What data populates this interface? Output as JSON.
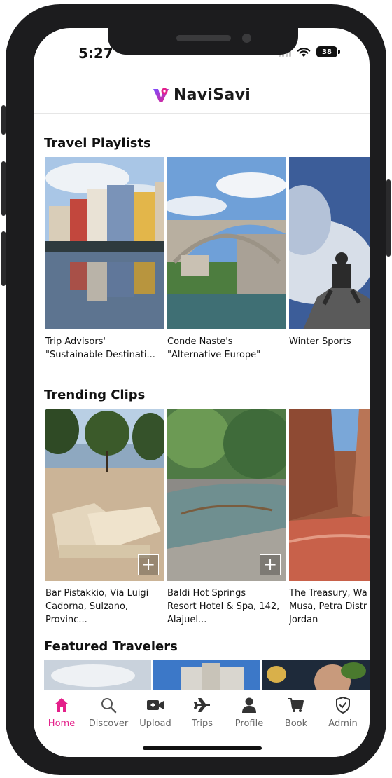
{
  "status_bar": {
    "time": "5:27",
    "battery": "38"
  },
  "header": {
    "app_name": "NaviSavi"
  },
  "travel_playlists": {
    "title": "Travel Playlists",
    "items": [
      {
        "label": "Trip Advisors'\n\"Sustainable Destinati..."
      },
      {
        "label": "Conde Naste's\n\"Alternative Europe\""
      },
      {
        "label": "Winter Sports"
      }
    ]
  },
  "trending_clips": {
    "title": "Trending Clips",
    "items": [
      {
        "label": "Bar Pistakkio, Via Luigi\nCadorna, Sulzano,\nProvinc..."
      },
      {
        "label": "Baldi Hot Springs\nResort Hotel & Spa, 142,\nAlajuel..."
      },
      {
        "label": "The Treasury, Wa\nMusa, Petra Distr\nJordan"
      }
    ],
    "add_button": "+"
  },
  "featured_travelers": {
    "title": "Featured Travelers"
  },
  "tab_bar": {
    "tabs": [
      {
        "label": "Home",
        "icon": "home-icon",
        "active": true
      },
      {
        "label": "Discover",
        "icon": "search-icon"
      },
      {
        "label": "Upload",
        "icon": "video-camera-icon"
      },
      {
        "label": "Trips",
        "icon": "airplane-icon"
      },
      {
        "label": "Profile",
        "icon": "person-icon"
      },
      {
        "label": "Book",
        "icon": "cart-icon"
      },
      {
        "label": "Admin",
        "icon": "shield-check-icon"
      }
    ]
  },
  "colors": {
    "accent": "#e4208a",
    "text": "#111111",
    "inactive_tab": "#666666",
    "logo_gradient": [
      "#7b4dff",
      "#e4208a"
    ]
  }
}
